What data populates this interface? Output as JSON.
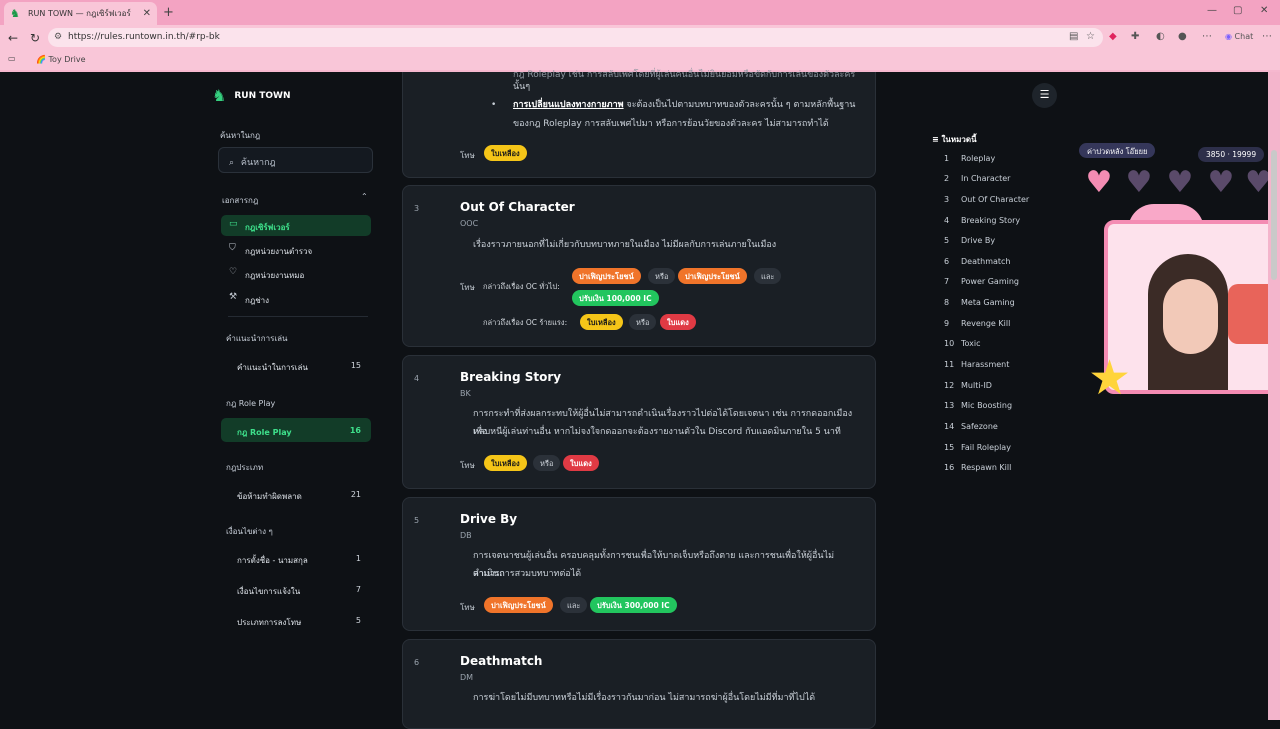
{
  "browser": {
    "tab_title": "RUN TOWN — กฎเซิร์ฟเวอร์",
    "url": "https://rules.runtown.in.th/#rp-bk",
    "bookmark": "Toy Drive",
    "chat_label": "Chat"
  },
  "logo": "RUN TOWN",
  "sidebar": {
    "search_label": "ค้นหาในกฎ",
    "search_placeholder": "ค้นหากฎ",
    "doc_section": "เอกสารกฎ",
    "doc_items": [
      {
        "label": "กฎเซิร์ฟเวอร์",
        "active": true
      },
      {
        "label": "กฎหน่วยงานตำรวจ"
      },
      {
        "label": "กฎหน่วยงานหมอ"
      },
      {
        "label": "กฎช่าง"
      }
    ],
    "groups": [
      {
        "title": "คำแนะนำการเล่น",
        "items": [
          {
            "label": "คำแนะนำในการเล่น",
            "count": "15"
          }
        ]
      },
      {
        "title": "กฎ Role Play",
        "items": [
          {
            "label": "กฎ Role Play",
            "count": "16",
            "active": true
          }
        ]
      },
      {
        "title": "กฎประเภท",
        "items": [
          {
            "label": "ข้อห้ามทำผิดพลาด",
            "count": "21"
          }
        ]
      },
      {
        "title": "เงื่อนไขต่าง ๆ",
        "items": [
          {
            "label": "การตั้งชื่อ - นามสกุล",
            "count": "1"
          },
          {
            "label": "เงื่อนไขการแจ้งใน",
            "count": "7"
          },
          {
            "label": "ประเภทการลงโทษ",
            "count": "5"
          }
        ]
      }
    ]
  },
  "topcard": {
    "line1": "กฎ Roleplay เช่น การสลับเพศโดยที่ผู้เล่นคนอื่นไม่ยินยอมหรือขัดกับการเล่นของตัวละคร",
    "line2": "นั้นๆ",
    "bullet_bold": "การเปลี่ยนแปลงทางกายภาพ",
    "bullet_rest": " จะต้องเป็นไปตามบทบาทของตัวละครนั้น ๆ ตามหลักพื้นฐาน",
    "line4": "ของกฎ Roleplay การสลับเพศไปมา หรือการย้อนวัยของตัวละคร ไม่สามารถทำได้",
    "penalty_label": "โทษ",
    "pill": "ใบเหลือง"
  },
  "rules": [
    {
      "num": "3",
      "title": "Out Of Character",
      "abbr": "OOC",
      "desc": [
        "เรื่องราวภายนอกที่ไม่เกี่ยวกับบทบาทภายในเมือง ไม่มีผลกับการเล่นภายในเมือง"
      ],
      "penalty_label": "โทษ",
      "sub1": "กล่าวถึงเรื่อง OC ทั่วไป:",
      "p1": "ปาเฟิญประโยชน์",
      "or": "หรือ",
      "p2": "ปาเฟิญประโยชน์",
      "and": "และ",
      "p3": "ปรับเงิน 100,000 IC",
      "sub2": "กล่าวถึงเรื่อง OC ร้ายแรง:",
      "p4": "ใบเหลือง",
      "p5": "ใบแดง"
    },
    {
      "num": "4",
      "title": "Breaking Story",
      "abbr": "BK",
      "desc": [
        "การกระทำที่ส่งผลกระทบให้ผู้อื่นไม่สามารถดำเนินเรื่องราวไปต่อได้โดยเจตนา เช่น การกดออกเมืองเพื่อ",
        "หลบหนีผู้เล่นท่านอื่น หากไม่จงใจกดออกจะต้องรายงานตัวใน Discord กับแอดมินภายใน 5 นาที"
      ],
      "penalty_label": "โทษ",
      "p1": "ใบเหลือง",
      "or": "หรือ",
      "p2": "ใบแดง"
    },
    {
      "num": "5",
      "title": "Drive By",
      "abbr": "DB",
      "desc": [
        "การเจตนาชนผู้เล่นอื่น ครอบคลุมทั้งการชนเพื่อให้บาดเจ็บหรือถึงตาย และการชนเพื่อให้ผู้อื่นไม่สามารถ",
        "ดำเนินการสวมบทบาทต่อได้"
      ],
      "penalty_label": "โทษ",
      "p1": "ปาเฟิญประโยชน์",
      "and": "และ",
      "p2": "ปรับเงิน 300,000 IC"
    },
    {
      "num": "6",
      "title": "Deathmatch",
      "abbr": "DM",
      "desc": [
        "การฆ่าโดยไม่มีบทบาทหรือไม่มีเรื่องราวกันมาก่อน ไม่สามารถฆ่าผู้อื่นโดยไม่มีที่มาที่ไปได้"
      ]
    }
  ],
  "toc": {
    "heading": "ในหมวดนี้",
    "items": [
      {
        "n": "1",
        "label": "Roleplay"
      },
      {
        "n": "2",
        "label": "In Character"
      },
      {
        "n": "3",
        "label": "Out Of Character"
      },
      {
        "n": "4",
        "label": "Breaking Story"
      },
      {
        "n": "5",
        "label": "Drive By"
      },
      {
        "n": "6",
        "label": "Deathmatch"
      },
      {
        "n": "7",
        "label": "Power Gaming"
      },
      {
        "n": "8",
        "label": "Meta Gaming"
      },
      {
        "n": "9",
        "label": "Revenge Kill"
      },
      {
        "n": "10",
        "label": "Toxic"
      },
      {
        "n": "11",
        "label": "Harassment"
      },
      {
        "n": "12",
        "label": "Multi-ID"
      },
      {
        "n": "13",
        "label": "Mic Boosting"
      },
      {
        "n": "14",
        "label": "Safezone"
      },
      {
        "n": "15",
        "label": "Fail Roleplay"
      },
      {
        "n": "16",
        "label": "Respawn Kill"
      }
    ]
  },
  "overlay": {
    "text": "ค่าปวดหลัง โอ๊ยยย",
    "counter": "3850 · 19999",
    "hearts_filled": 1,
    "hearts_total": 5
  },
  "colors": {
    "accent": "#35d07f",
    "yellow": "#f5c518",
    "orange": "#f0742a",
    "green": "#22c55e",
    "red": "#e03a44"
  }
}
